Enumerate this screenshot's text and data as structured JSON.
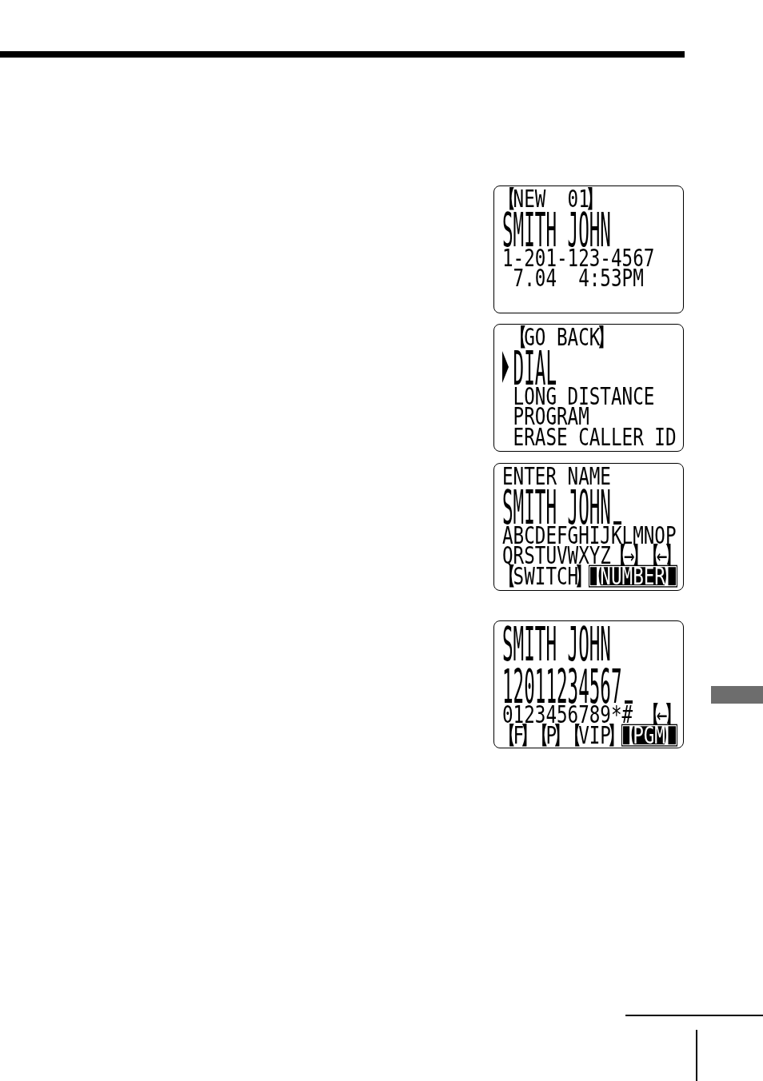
{
  "displays": [
    {
      "lines": [
        {
          "kind": "small",
          "text": "【NEW  01】",
          "cursor": false
        },
        {
          "kind": "large",
          "text": "SMITH JOHN",
          "cursor": false
        },
        {
          "kind": "small",
          "text": "1-201-123-4567",
          "cursor": false
        },
        {
          "kind": "small",
          "text": " 7.04  4:53PM",
          "cursor": false
        }
      ]
    },
    {
      "menu": [
        {
          "label": "【GO BACK】",
          "selected": false
        },
        {
          "label": "DIAL",
          "selected": true
        },
        {
          "label": "LONG DISTANCE",
          "selected": false
        },
        {
          "label": "PROGRAM",
          "selected": false
        },
        {
          "label": "ERASE CALLER ID",
          "selected": false
        }
      ]
    },
    {
      "lines": [
        {
          "kind": "small",
          "text": "ENTER NAME",
          "cursor": false
        },
        {
          "kind": "large",
          "text": "SMITH JOHN",
          "cursor": true
        },
        {
          "kind": "small",
          "text": "ABCDEFGHIJKLMNOP",
          "cursor": false
        },
        {
          "kind": "small",
          "text": "QRSTUVWXYZ",
          "cursor": false,
          "keys": [
            {
              "label": "【→】",
              "selected": false
            },
            {
              "label": "【←】",
              "selected": false
            }
          ]
        },
        {
          "kind": "small",
          "cursor": false,
          "keys": [
            {
              "label": "【SWITCH】",
              "selected": false
            },
            {
              "label": "【NUMBER】",
              "selected": true
            }
          ]
        }
      ]
    },
    {
      "lines": [
        {
          "kind": "large",
          "text": "SMITH JOHN",
          "cursor": false
        },
        {
          "kind": "large",
          "text": "12011234567",
          "cursor": true
        },
        {
          "kind": "small",
          "text": "0123456789*#",
          "cursor": false,
          "keys": [
            {
              "label": "【←】",
              "selected": false
            }
          ]
        },
        {
          "kind": "small",
          "cursor": false,
          "keys": [
            {
              "label": "【F】",
              "selected": false
            },
            {
              "label": "【P】",
              "selected": false
            },
            {
              "label": "【VIP】",
              "selected": false
            },
            {
              "label": "【PGM】",
              "selected": true
            }
          ]
        }
      ]
    }
  ]
}
